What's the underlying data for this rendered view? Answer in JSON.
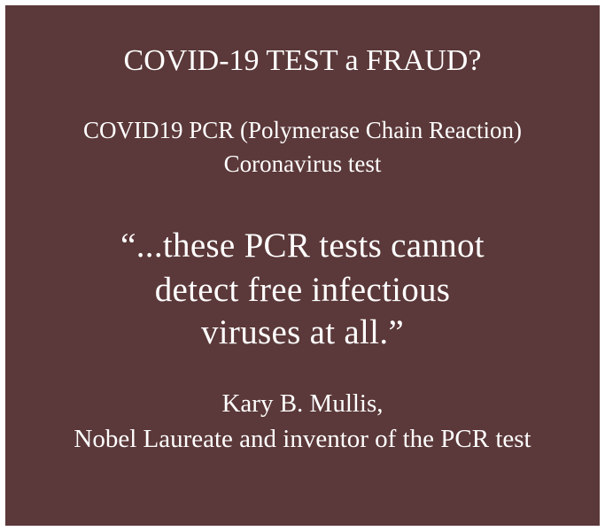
{
  "card": {
    "title": "COVID-19 TEST a FRAUD?",
    "subtitle_lines": [
      "COVID19 PCR (Polymerase Chain Reaction)",
      "Coronavirus test"
    ],
    "quote_lines": [
      "“...these PCR tests cannot",
      "detect free infectious",
      "viruses at all.”"
    ],
    "attribution_lines": [
      "Kary B. Mullis,",
      "Nobel Laureate and inventor of the PCR test"
    ]
  },
  "colors": {
    "background": "#5b3839",
    "text": "#ffffff",
    "border": "#ffffff"
  }
}
